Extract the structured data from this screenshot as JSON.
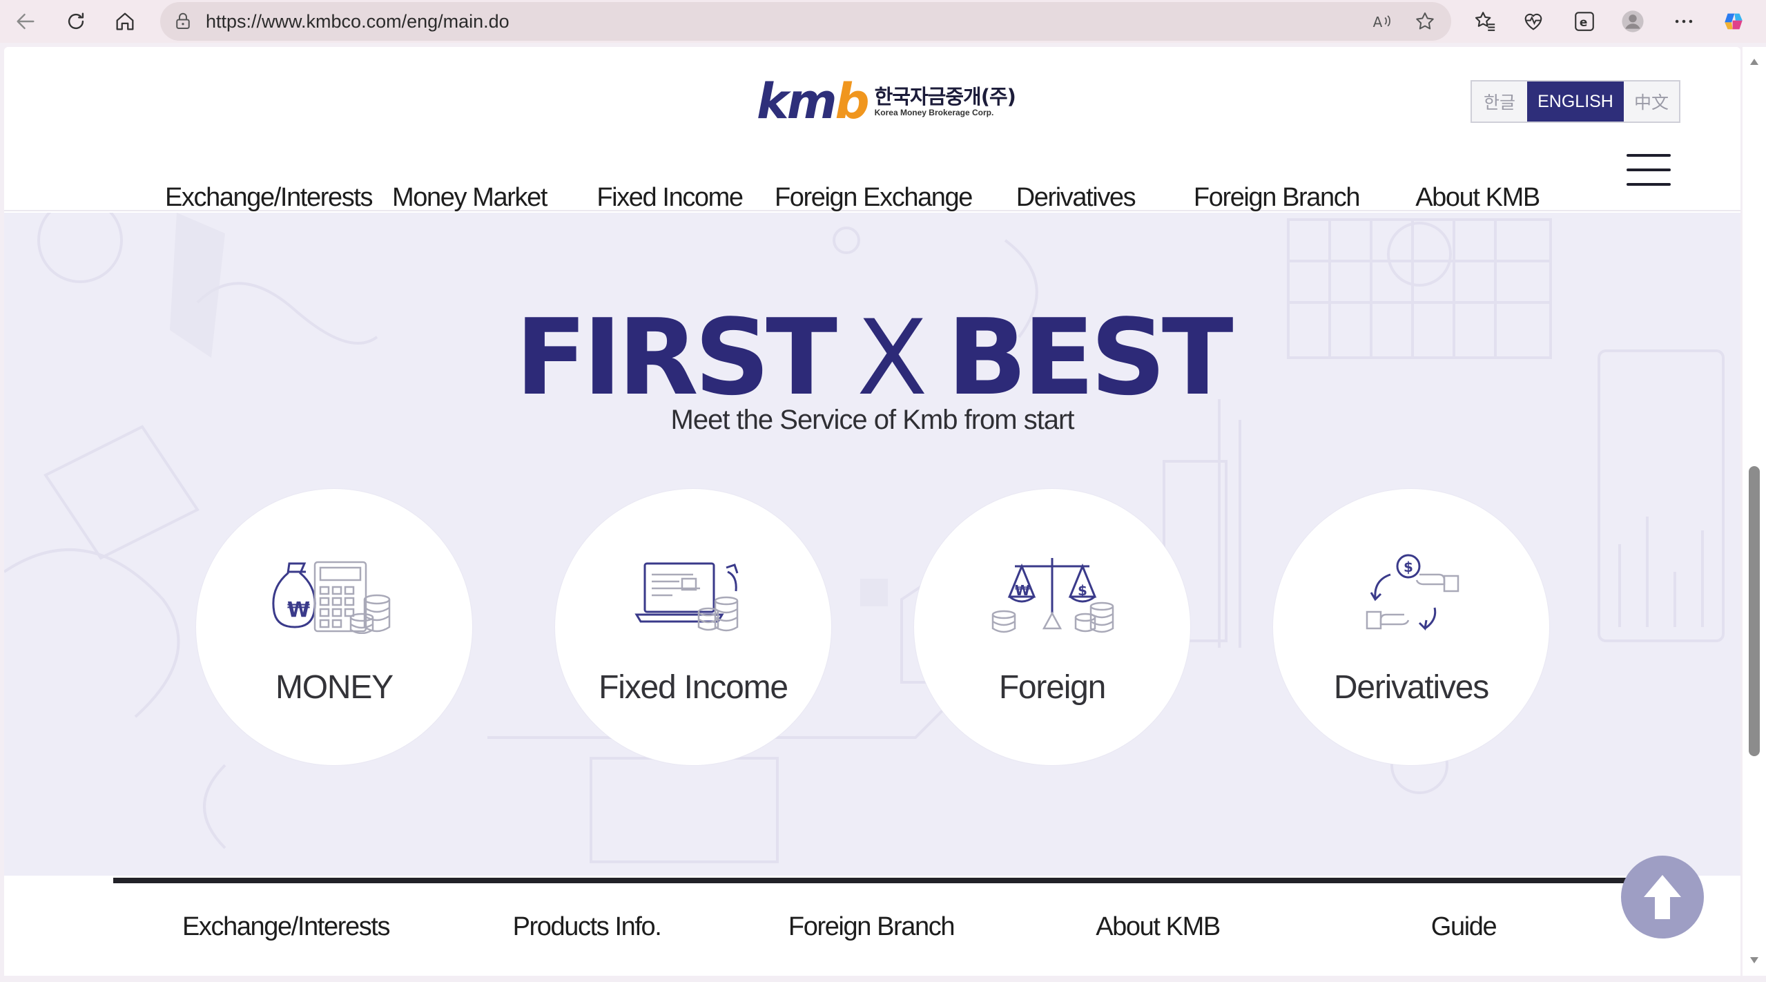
{
  "browser": {
    "url": "https://www.kmbco.com/eng/main.do"
  },
  "header": {
    "logo_mark": [
      "k",
      "m",
      "b"
    ],
    "logo_korean": "한국자금중개(주)",
    "logo_english": "Korea Money Brokerage Corp.",
    "languages": [
      "한글",
      "ENGLISH",
      "中文"
    ],
    "active_language": "ENGLISH",
    "nav": [
      "Exchange/Interests",
      "Money Market",
      "Fixed Income",
      "Foreign Exchange",
      "Derivatives",
      "Foreign Branch",
      "About KMB"
    ]
  },
  "hero": {
    "title_left": "FIRST",
    "title_x": "X",
    "title_right": "BEST",
    "subtitle": "Meet the Service of Kmb from start",
    "services": [
      {
        "label": "MONEY",
        "icon": "money-bag-calculator-icon"
      },
      {
        "label": "Fixed Income",
        "icon": "laptop-coins-icon"
      },
      {
        "label": "Foreign",
        "icon": "balance-scale-icon"
      },
      {
        "label": "Derivatives",
        "icon": "currency-exchange-hands-icon"
      }
    ]
  },
  "footer": {
    "links": [
      "Exchange/Interests",
      "Products Info.",
      "Foreign Branch",
      "About KMB",
      "Guide"
    ]
  },
  "colors": {
    "brand_navy": "#2d2a78",
    "brand_orange": "#f0961e",
    "hero_bg": "#eeedf7",
    "top_button": "#9e9ec4"
  }
}
